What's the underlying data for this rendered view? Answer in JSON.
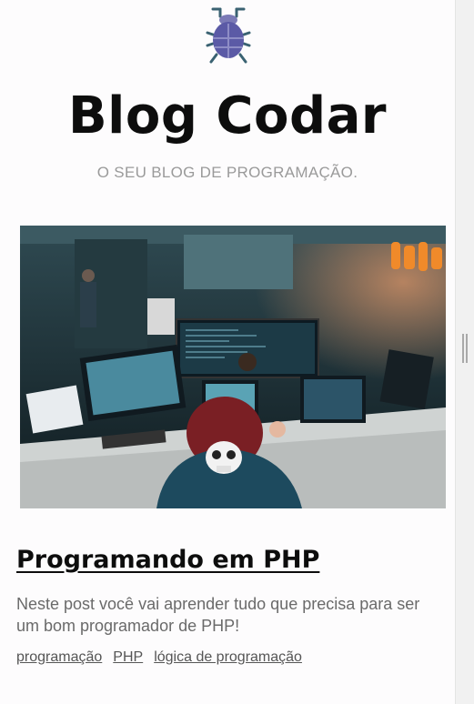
{
  "header": {
    "logo_icon": "bug-icon",
    "title": "Blog Codar",
    "tagline": "O SEU BLOG DE PROGRAMAÇÃO."
  },
  "post": {
    "image_icon": "workspace-photo",
    "title": "Programando em PHP",
    "excerpt": "Neste post você vai aprender tudo que precisa para ser um bom programador de PHP!",
    "tags": [
      "programação",
      "PHP",
      "lógica de programação"
    ]
  },
  "colors": {
    "logo_body": "#5b5aa6",
    "logo_legs": "#3a5f6e",
    "title": "#0d0d0d",
    "tagline": "#9a9a9a"
  }
}
